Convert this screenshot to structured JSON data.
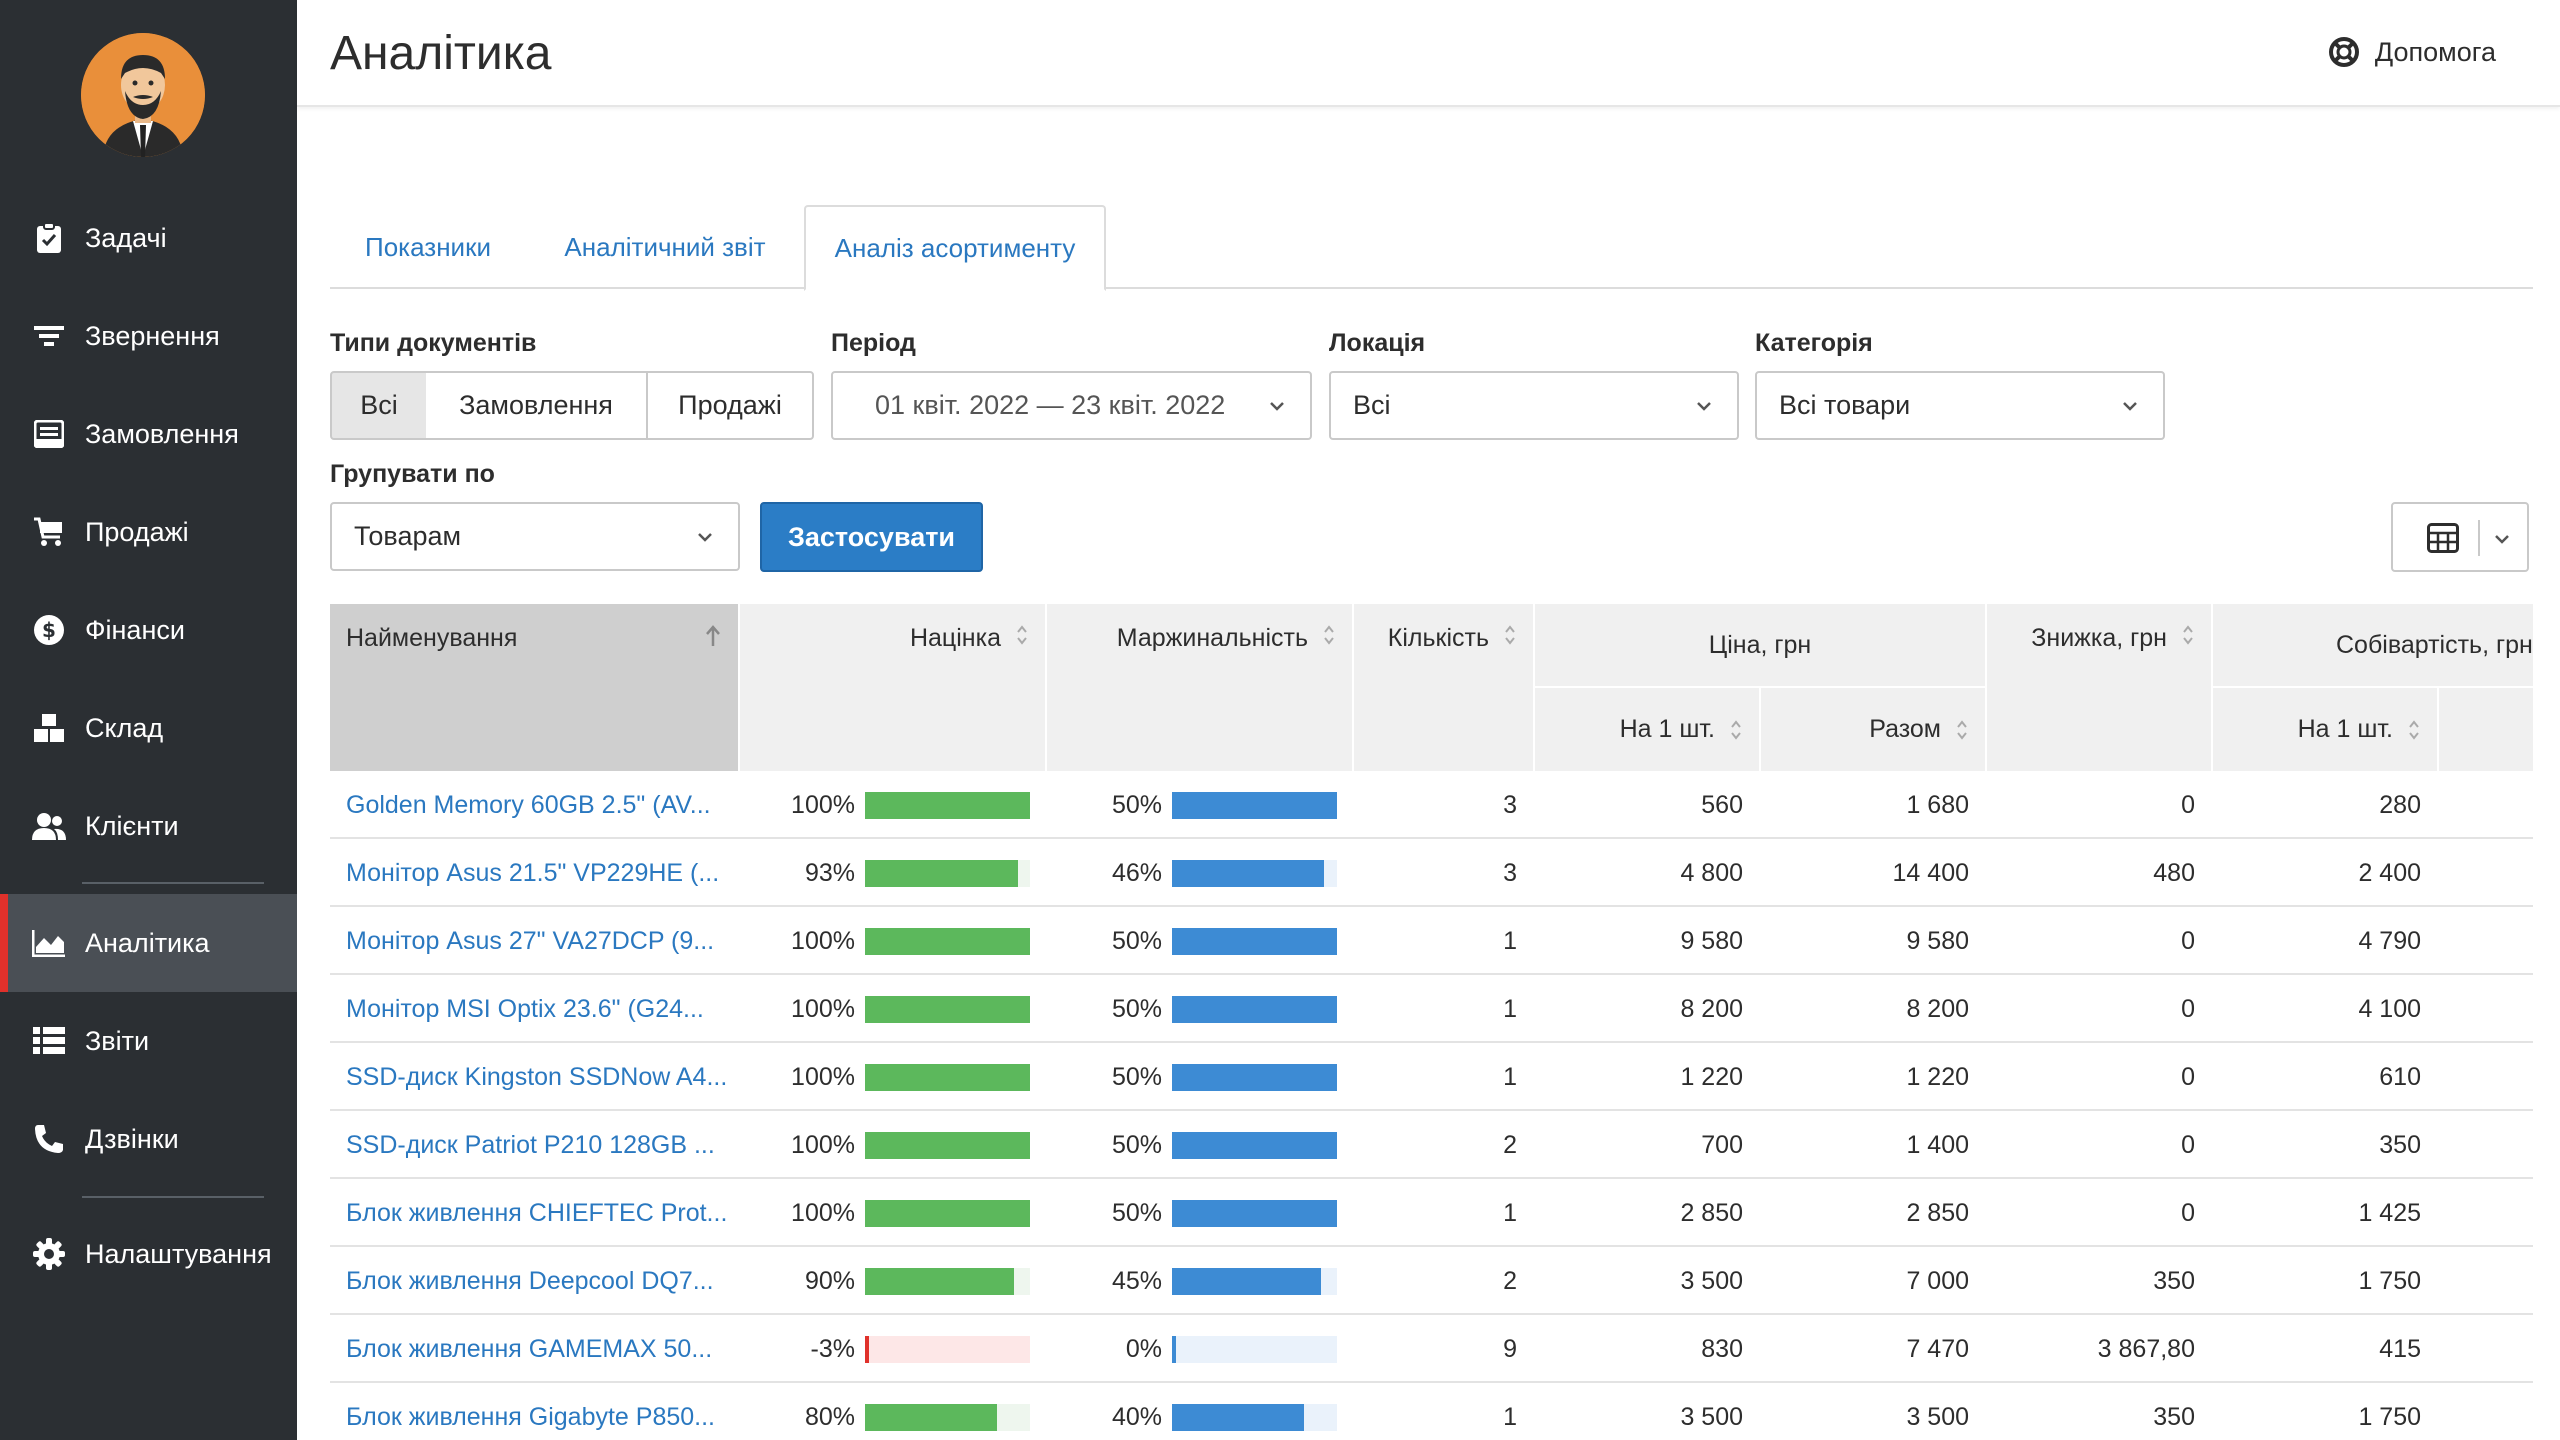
{
  "header": {
    "title": "Аналітика",
    "help_label": "Допомога"
  },
  "sidebar": {
    "items": [
      {
        "label": "Задачі",
        "icon": "clipboard-check-icon"
      },
      {
        "label": "Звернення",
        "icon": "filter-lines-icon"
      },
      {
        "label": "Замовлення",
        "icon": "inbox-icon"
      },
      {
        "label": "Продажі",
        "icon": "cart-icon"
      },
      {
        "label": "Фінанси",
        "icon": "dollar-circle-icon"
      },
      {
        "label": "Склад",
        "icon": "boxes-icon"
      },
      {
        "label": "Клієнти",
        "icon": "users-icon"
      },
      {
        "label": "Аналітика",
        "icon": "area-chart-icon",
        "active": true
      },
      {
        "label": "Звіти",
        "icon": "list-icon"
      },
      {
        "label": "Дзвінки",
        "icon": "phone-icon"
      },
      {
        "label": "Налаштування",
        "icon": "gear-icon"
      }
    ]
  },
  "tabs": [
    {
      "label": "Показники"
    },
    {
      "label": "Аналітичний звіт"
    },
    {
      "label": "Аналіз асортименту",
      "active": true
    }
  ],
  "filters": {
    "doc_types": {
      "label": "Типи документів",
      "options": [
        "Всі",
        "Замовлення",
        "Продажі"
      ],
      "selected": "Всі"
    },
    "period": {
      "label": "Період",
      "value": "01 квіт. 2022 — 23 квіт. 2022"
    },
    "location": {
      "label": "Локація",
      "value": "Всі"
    },
    "category": {
      "label": "Категорія",
      "value": "Всі товари"
    },
    "group_by": {
      "label": "Групувати по",
      "value": "Товарам"
    },
    "apply_label": "Застосувати"
  },
  "table": {
    "columns": {
      "name": "Найменування",
      "markup": "Націнка",
      "margin": "Маржинальність",
      "qty": "Кількість",
      "price": "Ціна, грн",
      "price_unit": "На 1 шт.",
      "price_total": "Разом",
      "discount": "Знижка, грн",
      "cost": "Собівартість, грн",
      "cost_unit": "На 1 шт."
    },
    "colors": {
      "markup_bar": "#5cb85c",
      "margin_bar": "#3d8bd4",
      "negative_bar": "#e0312b"
    },
    "rows": [
      {
        "name": "Golden Memory 60GB 2.5\" (AV...",
        "markup": "100%",
        "markup_val": 100,
        "margin": "50%",
        "margin_val": 50,
        "qty": "3",
        "price_unit": "560",
        "price_total": "1 680",
        "discount": "0",
        "cost_unit": "280"
      },
      {
        "name": "Монітор Asus 21.5\" VP229HE (...",
        "markup": "93%",
        "markup_val": 93,
        "margin": "46%",
        "margin_val": 46,
        "qty": "3",
        "price_unit": "4 800",
        "price_total": "14 400",
        "discount": "480",
        "cost_unit": "2 400"
      },
      {
        "name": "Монітор Asus 27\" VA27DCP (9...",
        "markup": "100%",
        "markup_val": 100,
        "margin": "50%",
        "margin_val": 50,
        "qty": "1",
        "price_unit": "9 580",
        "price_total": "9 580",
        "discount": "0",
        "cost_unit": "4 790"
      },
      {
        "name": "Монітор MSI Optix 23.6\" (G24...",
        "markup": "100%",
        "markup_val": 100,
        "margin": "50%",
        "margin_val": 50,
        "qty": "1",
        "price_unit": "8 200",
        "price_total": "8 200",
        "discount": "0",
        "cost_unit": "4 100"
      },
      {
        "name": "SSD-диск Kingston SSDNow A4...",
        "markup": "100%",
        "markup_val": 100,
        "margin": "50%",
        "margin_val": 50,
        "qty": "1",
        "price_unit": "1 220",
        "price_total": "1 220",
        "discount": "0",
        "cost_unit": "610"
      },
      {
        "name": "SSD-диск Patriot P210 128GB ...",
        "markup": "100%",
        "markup_val": 100,
        "margin": "50%",
        "margin_val": 50,
        "qty": "2",
        "price_unit": "700",
        "price_total": "1 400",
        "discount": "0",
        "cost_unit": "350"
      },
      {
        "name": "Блок живлення CHIEFTEC Prot...",
        "markup": "100%",
        "markup_val": 100,
        "margin": "50%",
        "margin_val": 50,
        "qty": "1",
        "price_unit": "2 850",
        "price_total": "2 850",
        "discount": "0",
        "cost_unit": "1 425"
      },
      {
        "name": "Блок живлення Deepcool DQ7...",
        "markup": "90%",
        "markup_val": 90,
        "margin": "45%",
        "margin_val": 45,
        "qty": "2",
        "price_unit": "3 500",
        "price_total": "7 000",
        "discount": "350",
        "cost_unit": "1 750"
      },
      {
        "name": "Блок живлення GAMEMAX 50...",
        "markup": "-3%",
        "markup_val": -3,
        "margin": "0%",
        "margin_val": 0,
        "qty": "9",
        "price_unit": "830",
        "price_total": "7 470",
        "discount": "3 867,80",
        "cost_unit": "415"
      },
      {
        "name": "Блок живлення Gigabyte P850...",
        "markup": "80%",
        "markup_val": 80,
        "margin": "40%",
        "margin_val": 40,
        "qty": "1",
        "price_unit": "3 500",
        "price_total": "3 500",
        "discount": "350",
        "cost_unit": "1 750"
      }
    ]
  }
}
